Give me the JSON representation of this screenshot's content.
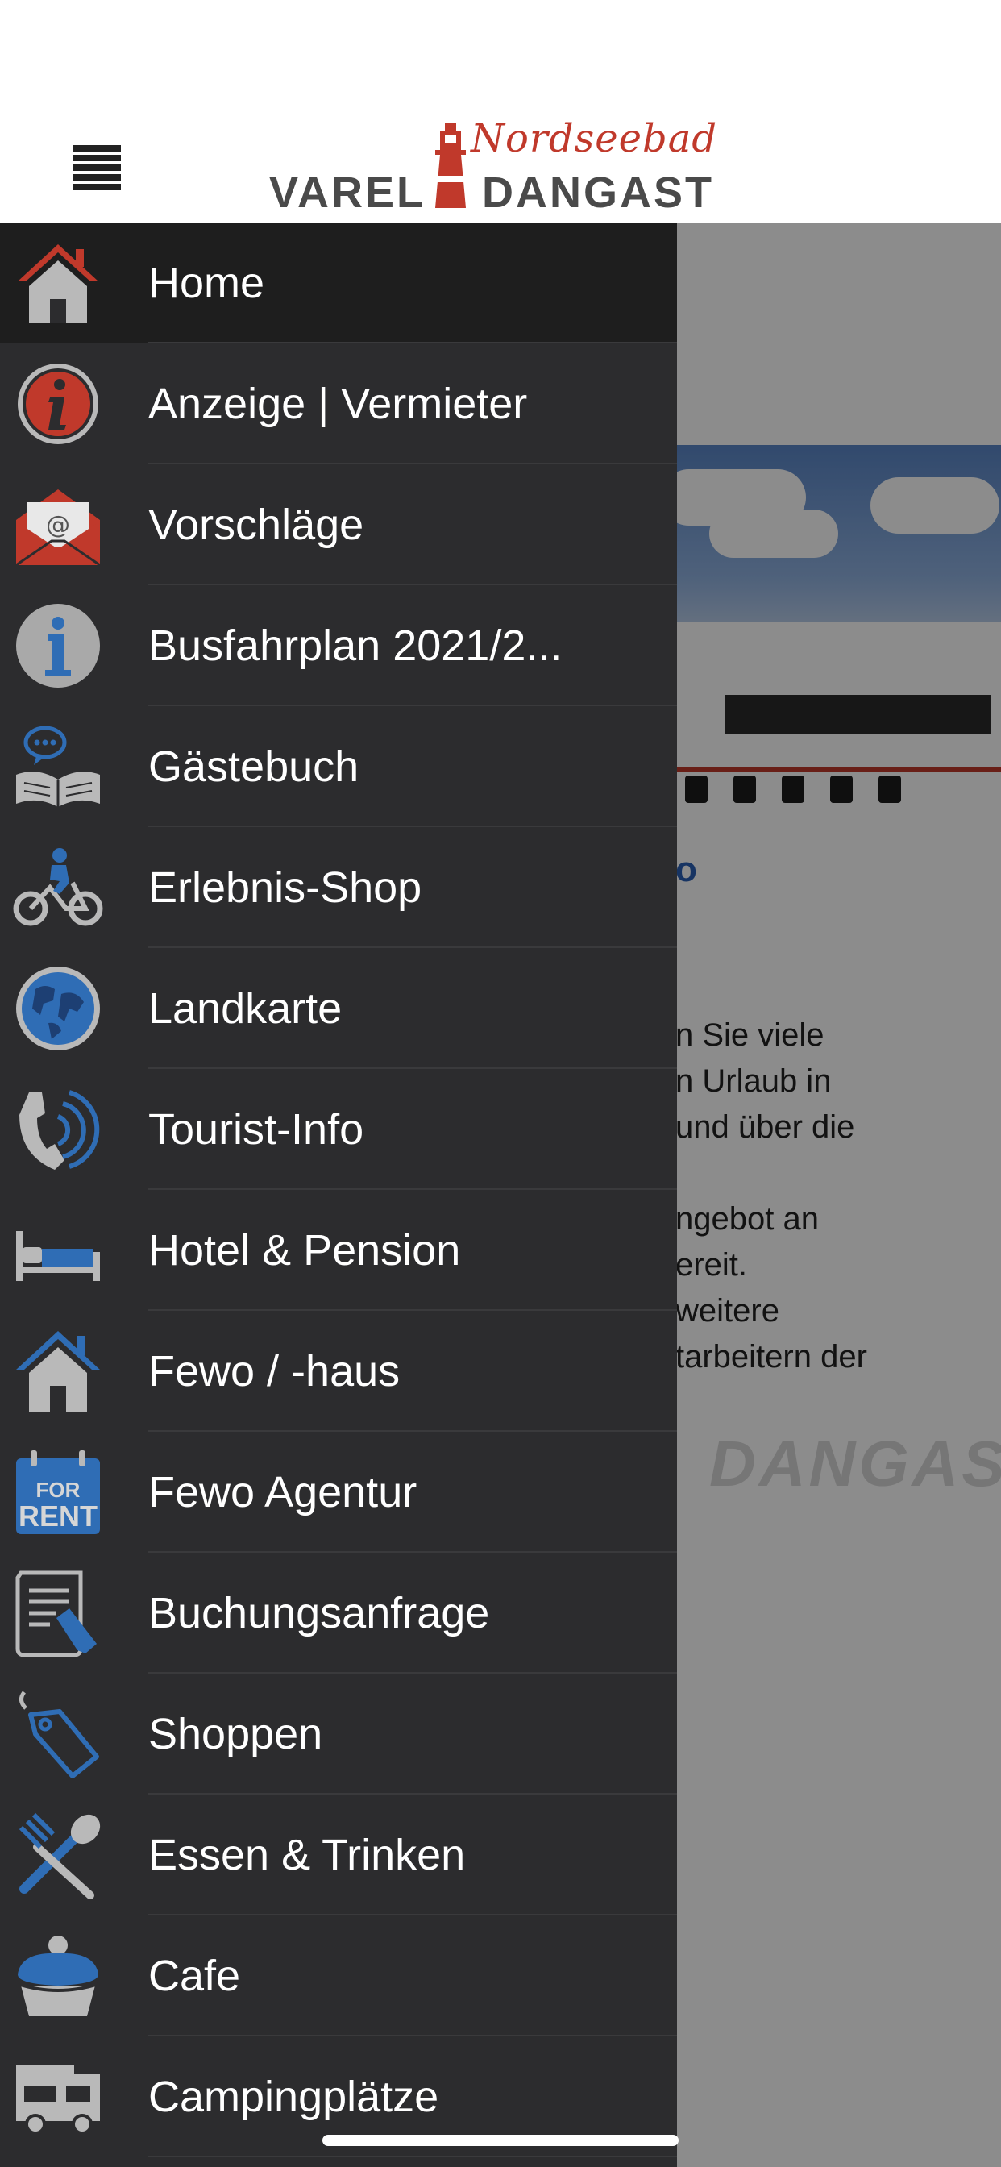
{
  "header": {
    "logo": {
      "script": "Nordseebad",
      "left": "VAREL",
      "right": "DANGAST"
    },
    "menu_button": "menu"
  },
  "background_page": {
    "heading_fragment": "o",
    "text_lines": [
      "n Sie viele",
      "n Urlaub in",
      "und über die",
      "",
      "ngebot an",
      "ereit.",
      "weitere",
      "tarbeitern der"
    ],
    "watermark": "DANGAS"
  },
  "menu": {
    "items": [
      {
        "label": "Home",
        "icon": "home-icon",
        "active": true
      },
      {
        "label": "Anzeige | Vermieter",
        "icon": "info-circle-icon"
      },
      {
        "label": "Vorschläge",
        "icon": "envelope-icon"
      },
      {
        "label": "Busfahrplan 2021/2...",
        "icon": "info-icon"
      },
      {
        "label": "Gästebuch",
        "icon": "guestbook-icon"
      },
      {
        "label": "Erlebnis-Shop",
        "icon": "bicycle-icon"
      },
      {
        "label": "Landkarte",
        "icon": "globe-icon"
      },
      {
        "label": "Tourist-Info",
        "icon": "phone-icon"
      },
      {
        "label": "Hotel & Pension",
        "icon": "bed-icon"
      },
      {
        "label": "Fewo / -haus",
        "icon": "house-icon"
      },
      {
        "label": "Fewo Agentur",
        "icon": "for-rent-icon",
        "icon_text": [
          "FOR",
          "RENT"
        ]
      },
      {
        "label": "Buchungsanfrage",
        "icon": "document-pen-icon"
      },
      {
        "label": "Shoppen",
        "icon": "price-tag-icon"
      },
      {
        "label": "Essen & Trinken",
        "icon": "fork-spoon-icon"
      },
      {
        "label": "Cafe",
        "icon": "cupcake-icon"
      },
      {
        "label": "Campingplätze",
        "icon": "camper-icon"
      }
    ]
  },
  "colors": {
    "drawer_bg": "#2c2c2e",
    "active_bg": "#1e1e1e",
    "accent_red": "#c0392b",
    "accent_blue": "#2f6db5",
    "icon_gray": "#b9b9b9",
    "text": "#ffffff"
  }
}
